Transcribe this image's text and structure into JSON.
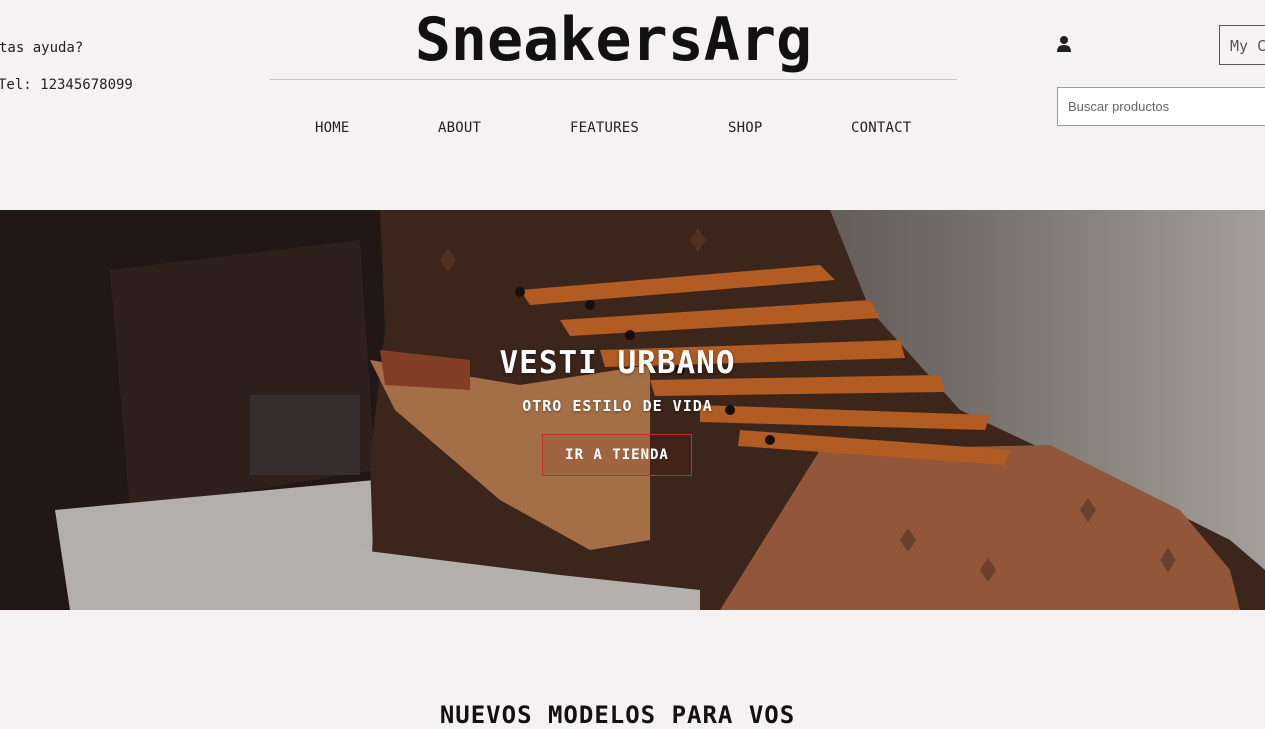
{
  "header": {
    "contact_question": "¿Necesitas ayuda?",
    "contact_phone": "Tel: 12345678099",
    "brand": "SneakersArg",
    "cart_label": "My Cart",
    "search_placeholder": "Buscar productos"
  },
  "nav": {
    "items": [
      {
        "label": "HOME"
      },
      {
        "label": "ABOUT"
      },
      {
        "label": "FEATURES"
      },
      {
        "label": "SHOP"
      },
      {
        "label": "CONTACT"
      }
    ]
  },
  "hero": {
    "title": "VESTI URBANO",
    "subtitle": "OTRO ESTILO DE VIDA",
    "cta_label": "IR A TIENDA"
  },
  "sections": {
    "new_models_heading": "NUEVOS MODELOS PARA VOS"
  },
  "colors": {
    "page_background": "#f4f2f2",
    "cta_border": "#c0302a",
    "lace_orange": "#d9702a"
  },
  "icons": {
    "user": "user-icon"
  }
}
